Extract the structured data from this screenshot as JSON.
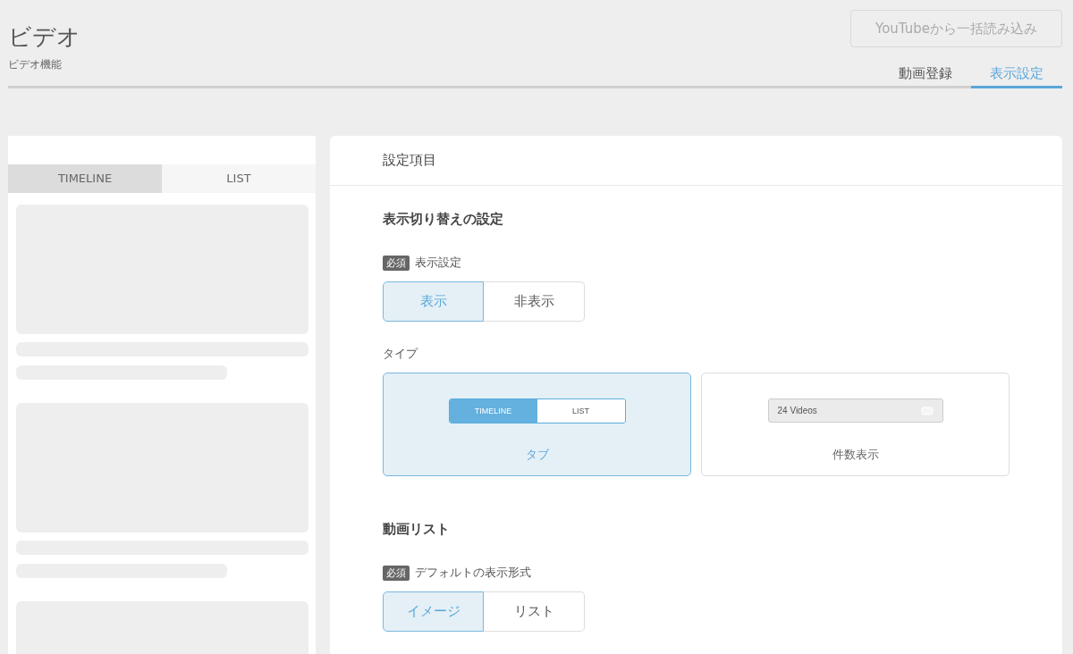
{
  "header": {
    "title": "ビデオ",
    "subtitle": "ビデオ機能",
    "import_button": {
      "label": "YouTubeから一括読み込み",
      "disabled": true
    },
    "tabs": [
      {
        "label": "動画登録",
        "selected": false
      },
      {
        "label": "表示設定",
        "selected": true
      }
    ]
  },
  "preview": {
    "tabs": [
      {
        "label": "TIMELINE",
        "selected": true
      },
      {
        "label": "LIST",
        "selected": false
      }
    ]
  },
  "settings": {
    "title": "設定項目",
    "sections": [
      {
        "heading": "表示切り替えの設定",
        "fields": [
          {
            "kind": "segmented",
            "badge": "必須",
            "label": "表示設定",
            "options": [
              {
                "label": "表示",
                "selected": true
              },
              {
                "label": "非表示",
                "selected": false
              }
            ]
          },
          {
            "kind": "cards",
            "label": "タイプ",
            "options": [
              {
                "kind": "tab_preview",
                "label": "タブ",
                "selected": true,
                "preview_tabs": [
                  {
                    "label": "TIMELINE",
                    "selected": true
                  },
                  {
                    "label": "LIST",
                    "selected": false
                  }
                ]
              },
              {
                "kind": "count_preview",
                "label": "件数表示",
                "selected": false,
                "count_text": "24 Videos"
              }
            ]
          }
        ]
      },
      {
        "heading": "動画リスト",
        "fields": [
          {
            "kind": "segmented",
            "badge": "必須",
            "label": "デフォルトの表示形式",
            "options": [
              {
                "label": "イメージ",
                "selected": true
              },
              {
                "label": "リスト",
                "selected": false
              }
            ]
          }
        ]
      }
    ]
  }
}
